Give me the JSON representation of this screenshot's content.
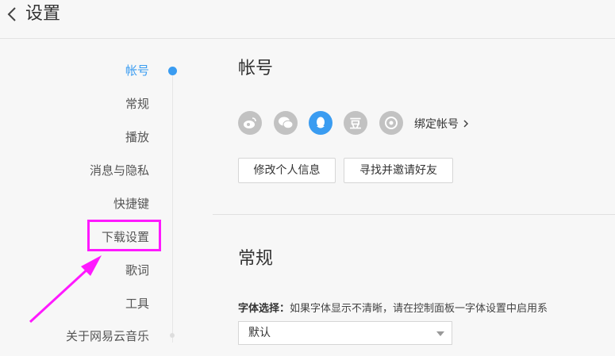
{
  "header": {
    "title": "设置"
  },
  "sidebar": {
    "items": [
      {
        "label": "帐号"
      },
      {
        "label": "常规"
      },
      {
        "label": "播放"
      },
      {
        "label": "消息与隐私"
      },
      {
        "label": "快捷键"
      },
      {
        "label": "下载设置"
      },
      {
        "label": "歌词"
      },
      {
        "label": "工具"
      },
      {
        "label": "关于网易云音乐"
      }
    ]
  },
  "account": {
    "title": "帐号",
    "social_icons": [
      "weibo-icon",
      "wechat-icon",
      "qq-icon",
      "douban-icon",
      "other-account-icon"
    ],
    "douban_glyph": "豆",
    "bind_label": "绑定帐号",
    "edit_profile_label": "修改个人信息",
    "find_friends_label": "寻找并邀请好友"
  },
  "general": {
    "title": "常规",
    "font_label": "字体选择：",
    "font_hint": "如果字体显示不清晰，请在控制面板一字体设置中启用系",
    "font_value": "默认"
  },
  "colors": {
    "accent": "#3a9cf1",
    "highlight": "#ff19ff",
    "icon_gray": "#c2c2c2"
  }
}
